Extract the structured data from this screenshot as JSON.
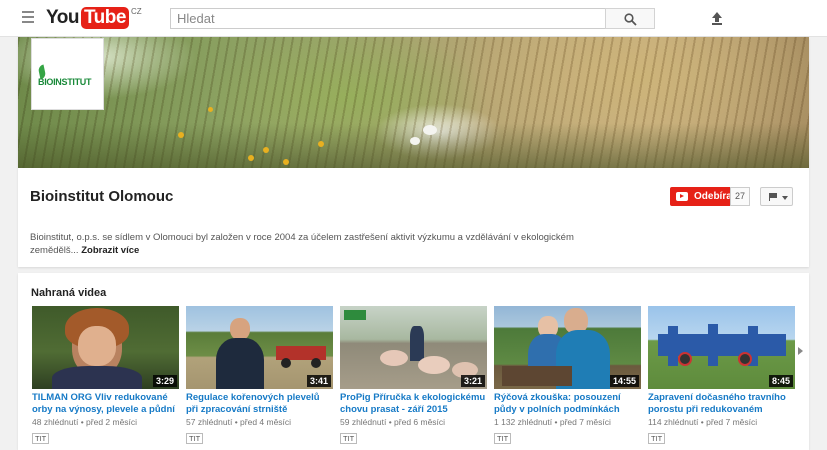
{
  "header": {
    "logo_you": "You",
    "logo_tube": "Tube",
    "logo_country": "CZ",
    "search_placeholder": "Hledat"
  },
  "channel": {
    "avatar_text": "BIOINSTITUT",
    "title": "Bioinstitut Olomouc",
    "subscribe_label": "Odebírat",
    "subscriber_count": "27",
    "description": "Bioinstitut, o.p.s. se sídlem v Olomouci byl založen v roce 2004 za účelem zastřešení aktivit výzkumu a vzdělávání v ekologickém zemědělš...",
    "show_more_label": "Zobrazit více"
  },
  "uploads": {
    "section_title": "Nahraná videa",
    "videos": [
      {
        "title": "TILMAN ORG Vliv redukované orby na výnosy, plevele a půdní",
        "views": "48 zhlédnutí",
        "age": "před 2 měsíci",
        "duration": "3:29",
        "badge": "TIT"
      },
      {
        "title": "Regulace kořenových plevelů při zpracování strniště podmítacím",
        "views": "57 zhlédnutí",
        "age": "před 4 měsíci",
        "duration": "3:41",
        "badge": "TIT"
      },
      {
        "title": "ProPig Příručka k ekologickému chovu prasat - září 2015",
        "views": "59 zhlédnutí",
        "age": "před 6 měsíci",
        "duration": "3:21",
        "badge": "TIT"
      },
      {
        "title": "Rýčová zkouška: posouzení půdy v polních podmínkách",
        "views": "1 132 zhlédnutí",
        "age": "před 7 měsíci",
        "duration": "14:55",
        "badge": "TIT"
      },
      {
        "title": "Zapravení dočasného travního porostu při redukovaném",
        "views": "114 zhlédnutí",
        "age": "před 7 měsíci",
        "duration": "8:45",
        "badge": "TIT"
      }
    ]
  }
}
